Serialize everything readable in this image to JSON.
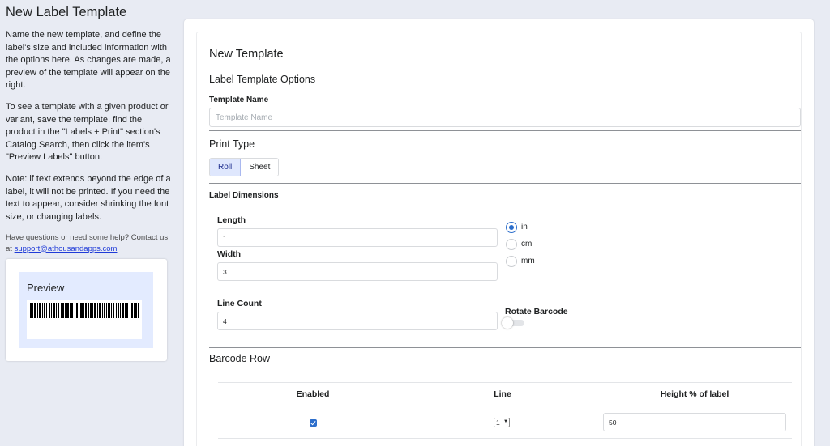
{
  "sidebar": {
    "title": "New Label Template",
    "intro": "Name the new template, and define the label's size and included information with the options here. As changes are made, a preview of the template will appear on the right.",
    "how_to": "To see a template with a given product or variant, save the template, find the product in the \"Labels + Print\" section's Catalog Search, then click the item's \"Preview Labels\" button.",
    "note": "Note: if text extends beyond the edge of a label, it will not be printed. If you need the text to appear, consider shrinking the font size, or changing labels.",
    "help_prefix": "Have questions or need some help? Contact us at",
    "help_email": "support@athousandapps.com",
    "preview_title": "Preview"
  },
  "form": {
    "heading": "New Template",
    "subheading": "Label Template Options",
    "template_name_label": "Template Name",
    "template_name_placeholder": "Template Name",
    "template_name_value": "",
    "print_type_heading": "Print Type",
    "print_type_options": [
      "Roll",
      "Sheet"
    ],
    "print_type_selected": "Roll",
    "dimensions_heading": "Label Dimensions",
    "length_label": "Length",
    "length_value": "1",
    "width_label": "Width",
    "width_value": "3",
    "units": [
      "in",
      "cm",
      "mm"
    ],
    "unit_selected": "in",
    "line_count_label": "Line Count",
    "line_count_value": "4",
    "rotate_barcode_label": "Rotate Barcode",
    "rotate_barcode_on": false
  },
  "barcode_row": {
    "heading": "Barcode Row",
    "columns": [
      "Enabled",
      "Line",
      "Height % of label"
    ],
    "enabled": true,
    "line": "1",
    "height_value": "50"
  },
  "colors": {
    "accent": "#2c6ecb",
    "page_bg": "#e8ebf3",
    "preview_bg": "#e3ebff",
    "link": "#1f3bd8"
  }
}
